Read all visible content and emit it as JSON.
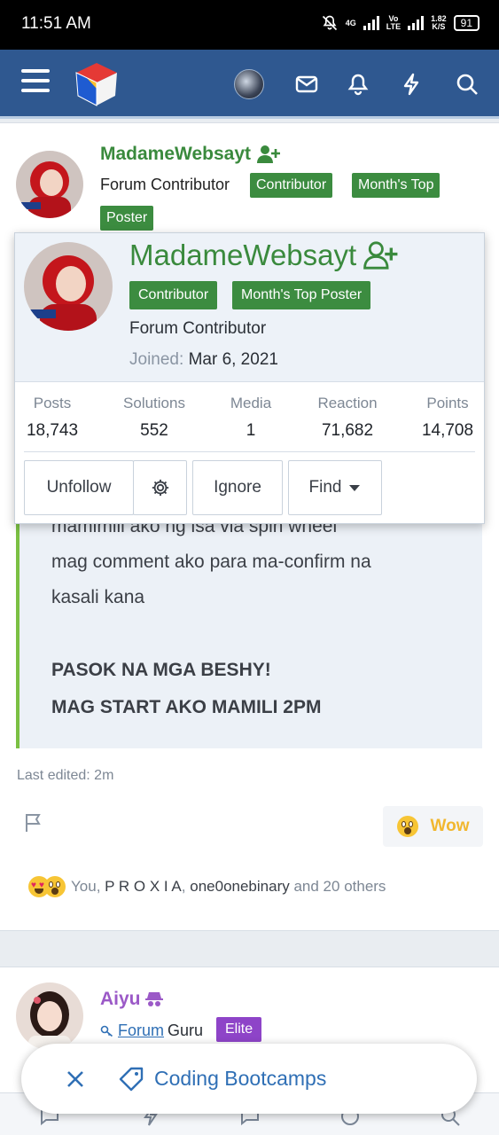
{
  "status_bar": {
    "time": "11:51 AM",
    "network_top": "4G",
    "volte_top": "Vo",
    "volte_bottom": "LTE",
    "speed_top": "1.82",
    "speed_bottom": "K/S",
    "battery": "91"
  },
  "post1": {
    "author": "MadameWebsayt",
    "user_title": "Forum Contributor",
    "badges": [
      "Contributor",
      "Month's Top",
      "Poster"
    ],
    "quote_lines": [
      "mamimili ako ng isa via spin wheel",
      "mag comment ako para ma-confirm na",
      "kasali kana"
    ],
    "quote_bold": [
      "PASOK NA MGA BESHY!",
      "MAG START AKO MAMILI 2PM"
    ],
    "last_edited": "Last edited: 2m",
    "reaction_label": "Wow",
    "reactors": {
      "you": "You,",
      "user1": "P R O X I A",
      "sep": ",",
      "user2": "one0onebinary",
      "others": "and 20 others"
    }
  },
  "popup": {
    "name": "MadameWebsayt",
    "badges": [
      "Contributor",
      "Month's Top Poster"
    ],
    "user_title": "Forum Contributor",
    "joined_label": "Joined:",
    "joined_value": "Mar 6, 2021",
    "stats": [
      {
        "label": "Posts",
        "value": "18,743"
      },
      {
        "label": "Solutions",
        "value": "552"
      },
      {
        "label": "Media",
        "value": "1"
      },
      {
        "label": "Reaction",
        "value": "71,682"
      },
      {
        "label": "Points",
        "value": "14,708"
      }
    ],
    "buttons": {
      "unfollow": "Unfollow",
      "ignore": "Ignore",
      "find": "Find"
    }
  },
  "post2": {
    "author": "Aiyu",
    "rank_link": "Forum",
    "rank_suffix": "Guru",
    "badge": "Elite"
  },
  "toast": {
    "text": "Coding Bootcamps"
  },
  "colors": {
    "nav": "#2f5890",
    "green_badge": "#3c8c40",
    "link": "#2f6fb5",
    "elite": "#8e44c8"
  }
}
